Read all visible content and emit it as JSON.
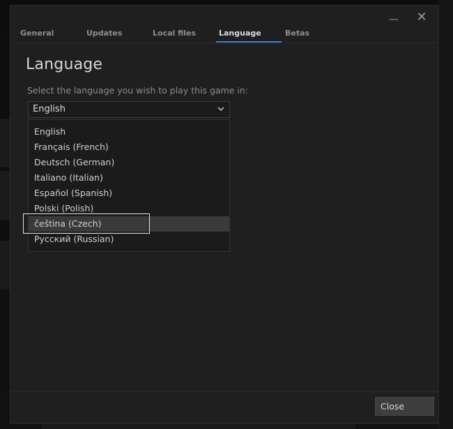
{
  "window": {
    "minimize_glyph": "—",
    "close_glyph": "✕"
  },
  "tabs": [
    {
      "label": "General"
    },
    {
      "label": "Updates"
    },
    {
      "label": "Local files"
    },
    {
      "label": "Language",
      "active": true
    },
    {
      "label": "Betas"
    }
  ],
  "heading": "Language",
  "prompt": "Select the language you wish to play this game in:",
  "select": {
    "value": "English",
    "icon": "chevron-down-icon"
  },
  "options": [
    {
      "label": "English"
    },
    {
      "label": "Français (French)"
    },
    {
      "label": "Deutsch (German)"
    },
    {
      "label": "Italiano (Italian)"
    },
    {
      "label": "Español (Spanish)"
    },
    {
      "label": "Polski (Polish)"
    },
    {
      "label": "čeština (Czech)",
      "hovered": true
    },
    {
      "label": "Русский (Russian)"
    }
  ],
  "footer": {
    "close_label": "Close"
  },
  "colors": {
    "accent": "#3b7bd0",
    "dialog_bg": "#1f1f1f",
    "hover_bg": "#3a3a3a"
  }
}
